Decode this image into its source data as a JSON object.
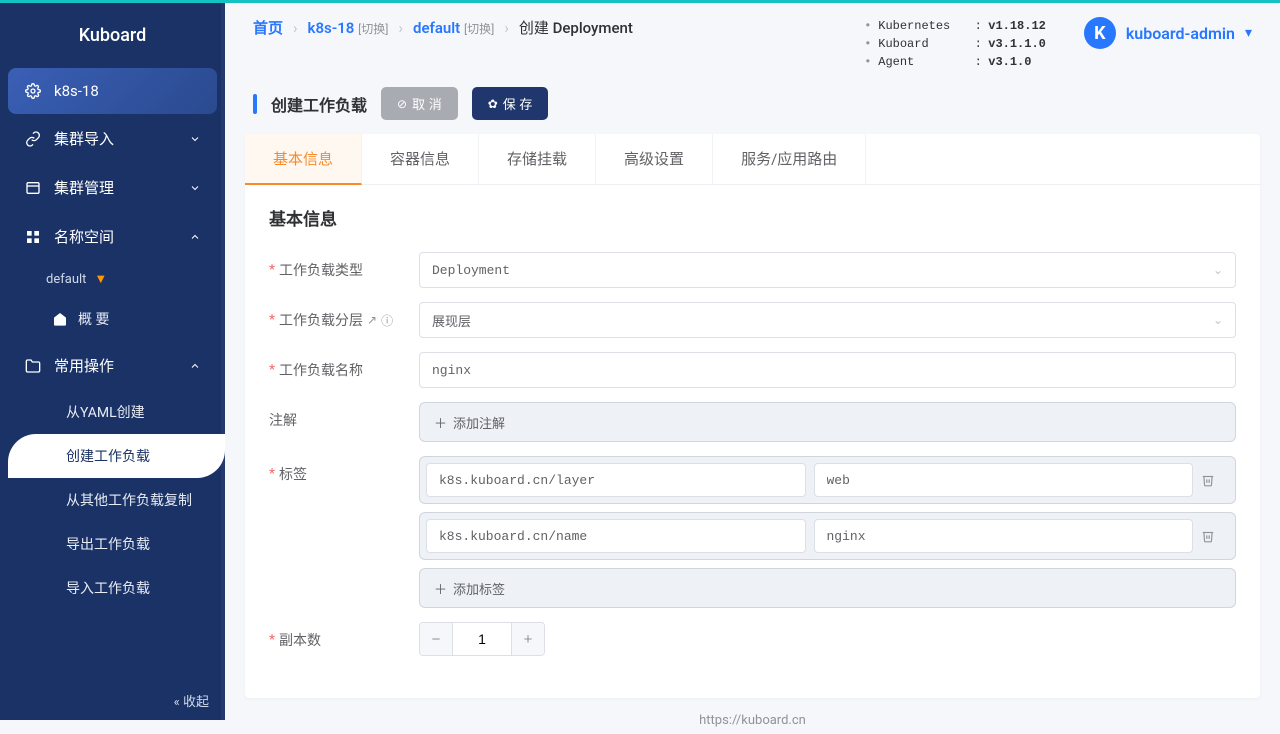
{
  "brand": "Kuboard",
  "sidebar": {
    "cluster": "k8s-18",
    "items": {
      "import": "集群导入",
      "manage": "集群管理",
      "namespace": "名称空间"
    },
    "namespace_value": "default",
    "summary": "概 要",
    "common_ops": "常用操作",
    "sub": {
      "yaml": "从YAML创建",
      "create_workload": "创建工作负载",
      "copy_from": "从其他工作负载复制",
      "export": "导出工作负载",
      "import_wl": "导入工作负载"
    },
    "collapse": "收起"
  },
  "breadcrumbs": {
    "home": "首页",
    "cluster": "k8s-18",
    "switch": "[切换]",
    "ns": "default",
    "current": "创建 Deployment"
  },
  "versions": {
    "k8s_label": "Kubernetes",
    "k8s_value": "v1.18.12",
    "kuboard_label": "Kuboard",
    "kuboard_value": "v3.1.1.0",
    "agent_label": "Agent",
    "agent_value": "v3.1.0"
  },
  "user": {
    "initial": "K",
    "name": "kuboard-admin"
  },
  "page": {
    "title": "创建工作负载",
    "cancel": "取 消",
    "save": "保 存"
  },
  "tabs": {
    "basic": "基本信息",
    "container": "容器信息",
    "storage": "存储挂载",
    "advanced": "高级设置",
    "service": "服务/应用路由"
  },
  "form": {
    "section_title": "基本信息",
    "type_label": "工作负载类型",
    "type_value": "Deployment",
    "layer_label": "工作负载分层",
    "layer_value": "展现层",
    "name_label": "工作负载名称",
    "name_value": "nginx",
    "anno_label": "注解",
    "add_anno": "添加注解",
    "tags_label": "标签",
    "tags": [
      {
        "key": "k8s.kuboard.cn/layer",
        "val": "web"
      },
      {
        "key": "k8s.kuboard.cn/name",
        "val": "nginx"
      }
    ],
    "add_tag": "添加标签",
    "replicas_label": "副本数",
    "replicas_value": "1"
  },
  "footer_url": "https://kuboard.cn"
}
